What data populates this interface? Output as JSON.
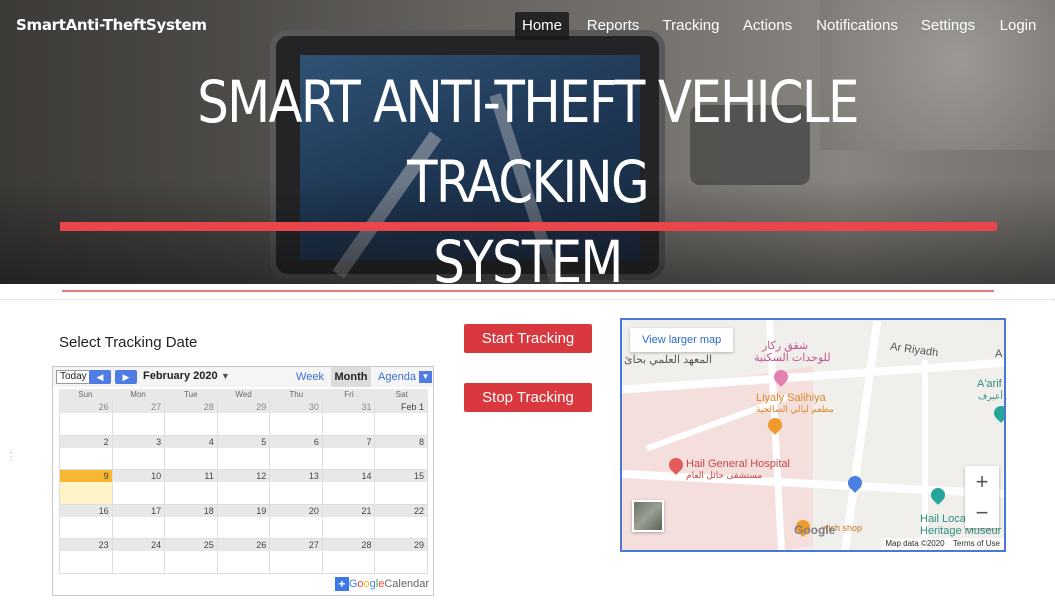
{
  "navbar": {
    "brand": "SmartAnti-TheftSystem",
    "items": [
      {
        "label": "Home",
        "active": true
      },
      {
        "label": "Reports"
      },
      {
        "label": "Tracking"
      },
      {
        "label": "Actions"
      },
      {
        "label": "Notifications"
      },
      {
        "label": "Settings"
      },
      {
        "label": "Login"
      }
    ]
  },
  "hero": {
    "headline_line1": "SMART ANTI-THEFT VEHICLE TRACKING",
    "headline_line2": "SYSTEM",
    "accent_color": "#e8464a"
  },
  "calendar": {
    "section_title": "Select Tracking Date",
    "today_label": "Today",
    "month_label": "February 2020",
    "views": [
      "Week",
      "Month",
      "Agenda"
    ],
    "selected_view": "Month",
    "weekdays": [
      "Sun",
      "Mon",
      "Tue",
      "Wed",
      "Thu",
      "Fri",
      "Sat"
    ],
    "weeks": [
      [
        "26",
        "27",
        "28",
        "29",
        "30",
        "31",
        "Feb 1"
      ],
      [
        "2",
        "3",
        "4",
        "5",
        "6",
        "7",
        "8"
      ],
      [
        "9",
        "10",
        "11",
        "12",
        "13",
        "14",
        "15"
      ],
      [
        "16",
        "17",
        "18",
        "19",
        "20",
        "21",
        "22"
      ],
      [
        "23",
        "24",
        "25",
        "26",
        "27",
        "28",
        "29"
      ]
    ],
    "today": "9",
    "footer_brand_g": "G",
    "footer_brand_o1": "o",
    "footer_brand_o2": "o",
    "footer_brand_g2": "g",
    "footer_brand_l": "l",
    "footer_brand_e": "e",
    "footer_product": "Calendar"
  },
  "actions": {
    "start_label": "Start Tracking",
    "stop_label": "Stop Tracking"
  },
  "map": {
    "view_larger": "View larger map",
    "labels": {
      "ar_riyadh": "Ar Riyadh",
      "a_arif": "A'arif",
      "a_arif_ar": "أعيرف",
      "a_short": "A",
      "shaq_rakar": "شقق ركار",
      "housing_units": "للوحدات السكنية",
      "scientific_institute": "المعهد العلمي بحائ",
      "liyaly_salihiya": "Liyaly Salihiya",
      "liyaly_ar": "مطعم ليالي الصالحية",
      "hospital": "Hail General Hospital",
      "hospital_ar": "مستشفى حائل العام",
      "hail_local": "Hail Loca",
      "heritage": "Heritage Museur",
      "sandwich": "wich shop"
    },
    "zoom_in": "+",
    "zoom_out": "−",
    "attribution_data": "Map data ©2020",
    "attribution_terms": "Terms of Use",
    "google_logo": "Google"
  }
}
